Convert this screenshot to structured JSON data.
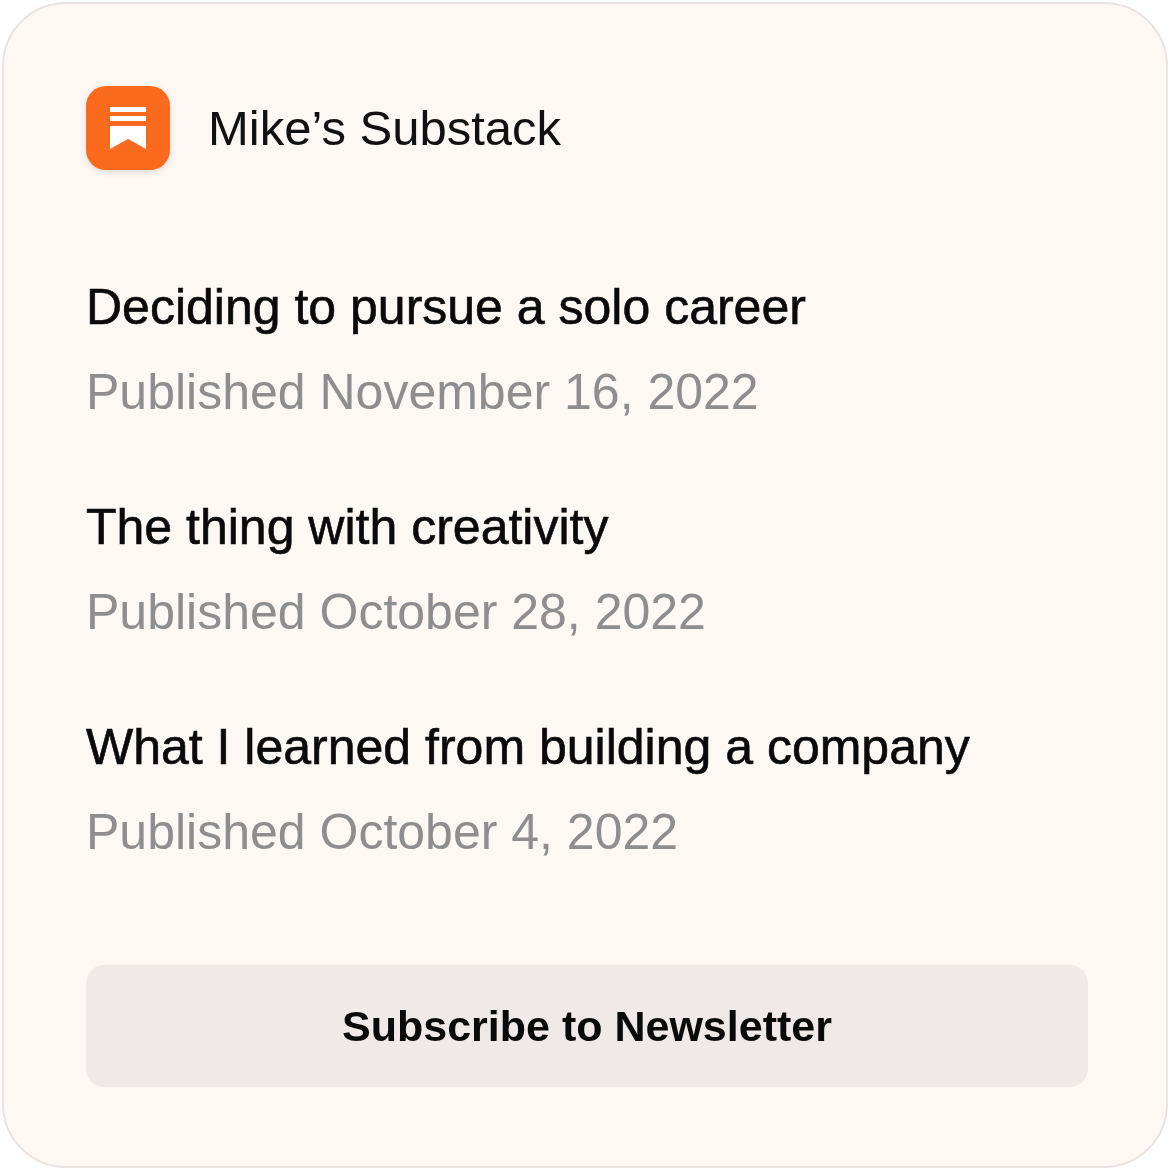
{
  "header": {
    "title": "Mike’s Substack"
  },
  "posts": [
    {
      "title": "Deciding to pursue a solo career",
      "date": "Published November 16, 2022"
    },
    {
      "title": "The thing with creativity",
      "date": "Published October 28, 2022"
    },
    {
      "title": "What I learned from building a company",
      "date": "Published October 4, 2022"
    }
  ],
  "subscribe_button": {
    "label": "Subscribe to Newsletter"
  }
}
